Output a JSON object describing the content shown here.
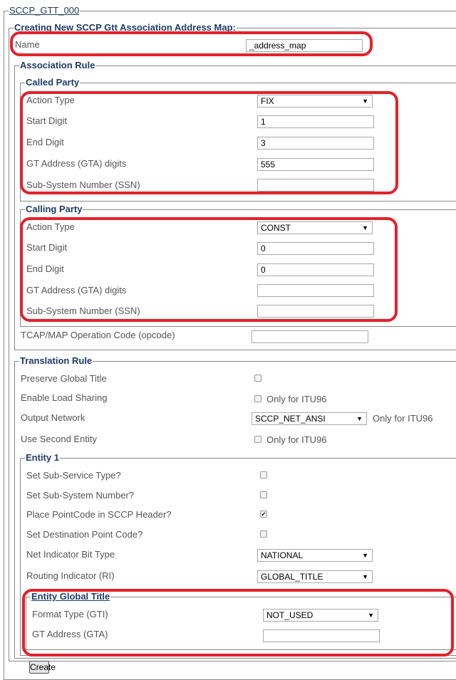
{
  "outer_legend": "SCCP_GTT_000",
  "form_legend": "Creating New SCCP Gtt Association Address Map:",
  "name": {
    "label": "Name",
    "value": "_address_map"
  },
  "association": {
    "legend": "Association Rule",
    "called": {
      "legend": "Called Party",
      "action_label": "Action Type",
      "action_value": "FIX",
      "start_label": "Start Digit",
      "start_value": "1",
      "end_label": "End Digit",
      "end_value": "3",
      "gta_label": "GT Address (GTA) digits",
      "gta_value": "555",
      "ssn_label": "Sub-System Number (SSN)",
      "ssn_value": ""
    },
    "calling": {
      "legend": "Calling Party",
      "action_label": "Action Type",
      "action_value": "CONST",
      "start_label": "Start Digit",
      "start_value": "0",
      "end_label": "End Digit",
      "end_value": "0",
      "gta_label": "GT Address (GTA) digits",
      "gta_value": "",
      "ssn_label": "Sub-System Number (SSN)",
      "ssn_value": ""
    },
    "opcode_label": "TCAP/MAP Operation Code (opcode)",
    "opcode_value": ""
  },
  "translation": {
    "legend": "Translation Rule",
    "preserve_label": "Preserve Global Title",
    "preserve_checked": false,
    "load_label": "Enable Load Sharing",
    "load_checked": false,
    "load_note": "Only for ITU96",
    "network_label": "Output Network",
    "network_value": "SCCP_NET_ANSI",
    "network_note": "Only for ITU96",
    "second_label": "Use Second Entity",
    "second_checked": false,
    "second_note": "Only for ITU96",
    "entity1": {
      "legend": "Entity 1",
      "sst_label": "Set Sub-Service Type?",
      "sst_checked": false,
      "ssn_label": "Set Sub-System Number?",
      "ssn_checked": false,
      "pc_label": "Place PointCode in SCCP Header?",
      "pc_checked": true,
      "dpc_label": "Set Destination Point Code?",
      "dpc_checked": false,
      "nib_label": "Net Indicator Bit Type",
      "nib_value": "NATIONAL",
      "ri_label": "Routing Indicator (RI)",
      "ri_value": "GLOBAL_TITLE",
      "egt": {
        "legend": "Entity Global Title",
        "gti_label": "Format Type (GTI)",
        "gti_value": "NOT_USED",
        "gta_label": "GT Address (GTA)",
        "gta_value": ""
      }
    }
  },
  "create_label": "Create",
  "colors": {
    "highlight": "#e3212b",
    "legend": "#1f3b66"
  },
  "icons": {
    "dropdown": "dropdown-arrow-icon",
    "check": "checkmark-icon"
  }
}
